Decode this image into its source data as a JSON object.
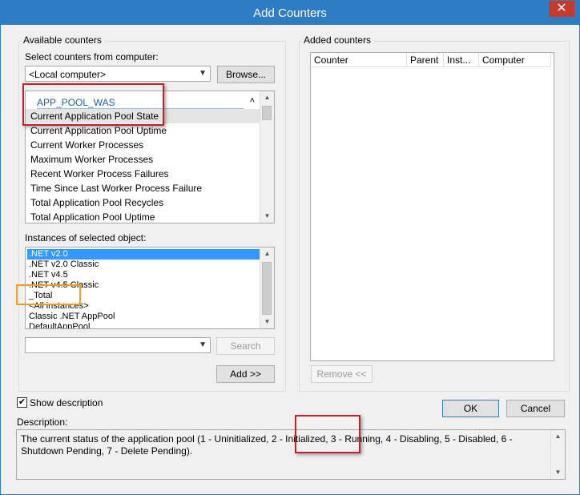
{
  "window": {
    "title": "Add Counters",
    "close_glyph": "✕"
  },
  "available": {
    "group_label": "Available counters",
    "select_label": "Select counters from computer:",
    "computer_value": "<Local computer>",
    "browse_label": "Browse...",
    "counter_group_name": "APP_POOL_WAS",
    "counters": [
      "Current Application Pool State",
      "Current Application Pool Uptime",
      "Current Worker Processes",
      "Maximum Worker Processes",
      "Recent Worker Process Failures",
      "Time Since Last Worker Process Failure",
      "Total Application Pool Recycles",
      "Total Application Pool Uptime"
    ],
    "instances_label": "Instances of selected object:",
    "instances": [
      ".NET v2.0",
      ".NET v2.0 Classic",
      ".NET v4.5",
      ".NET v4.5 Classic",
      "_Total",
      "<All instances>",
      "Classic .NET AppPool",
      "DefaultAppPool"
    ],
    "search_value": "",
    "search_label": "Search",
    "add_label": "Add >>"
  },
  "added": {
    "group_label": "Added counters",
    "columns": [
      "Counter",
      "Parent",
      "Inst...",
      "Computer"
    ],
    "remove_label": "Remove <<"
  },
  "footer": {
    "show_description_label": "Show description",
    "show_description_checked": true,
    "ok_label": "OK",
    "cancel_label": "Cancel",
    "description_label": "Description:",
    "description_text": "The current status of the application pool (1 - Uninitialized, 2 - Initialized, 3 - Running, 4 - Disabling, 5 - Disabled, 6 - Shutdown Pending, 7 - Delete Pending)."
  },
  "colors": {
    "titlebar": "#2e7cc4",
    "close": "#c7392b",
    "selection": "#3399ff",
    "highlight_red": "#c0202a",
    "highlight_orange": "#f39c1f"
  },
  "icons": {
    "dropdown": "chevron-down-icon",
    "check": "checkmark-icon",
    "collapse": "caret-up-icon"
  }
}
